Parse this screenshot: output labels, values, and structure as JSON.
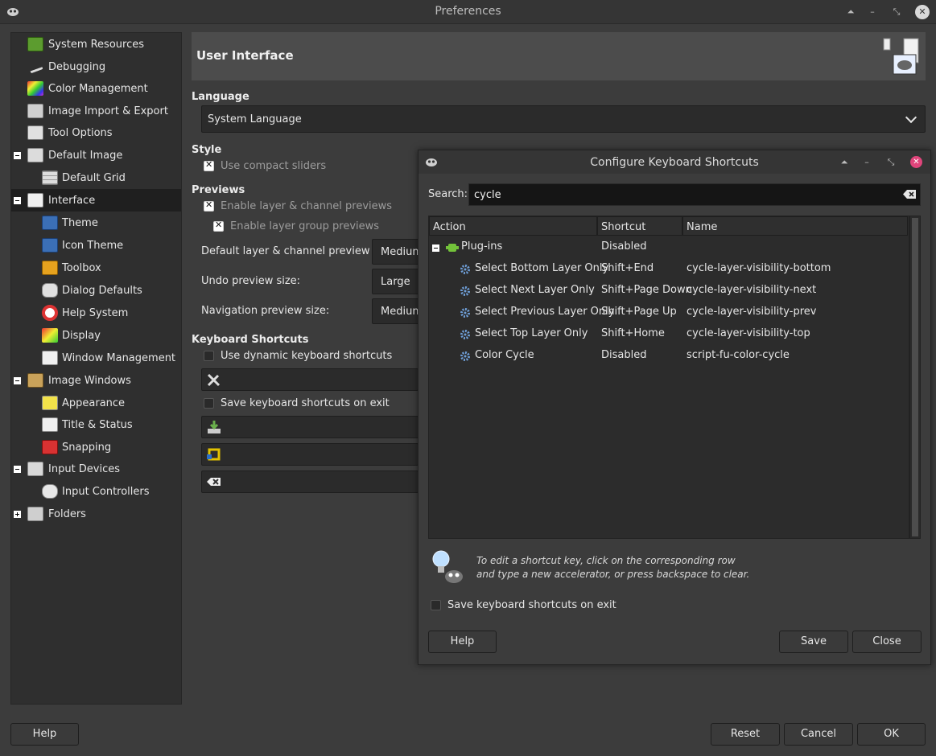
{
  "window": {
    "title": "Preferences"
  },
  "sidebar": {
    "items": [
      {
        "label": "System Resources",
        "icon": "system-resources-icon"
      },
      {
        "label": "Debugging",
        "icon": "debugging-icon"
      },
      {
        "label": "Color Management",
        "icon": "color-management-icon"
      },
      {
        "label": "Image Import & Export",
        "icon": "image-import-export-icon"
      },
      {
        "label": "Tool Options",
        "icon": "tool-options-icon"
      },
      {
        "label": "Default Image",
        "icon": "default-image-icon"
      },
      {
        "label": "Default Grid",
        "icon": "default-grid-icon"
      },
      {
        "label": "Interface",
        "icon": "interface-icon"
      },
      {
        "label": "Theme",
        "icon": "theme-icon"
      },
      {
        "label": "Icon Theme",
        "icon": "icon-theme-icon"
      },
      {
        "label": "Toolbox",
        "icon": "toolbox-icon"
      },
      {
        "label": "Dialog Defaults",
        "icon": "dialog-defaults-icon"
      },
      {
        "label": "Help System",
        "icon": "help-system-icon"
      },
      {
        "label": "Display",
        "icon": "display-icon"
      },
      {
        "label": "Window Management",
        "icon": "window-management-icon"
      },
      {
        "label": "Image Windows",
        "icon": "image-windows-icon"
      },
      {
        "label": "Appearance",
        "icon": "appearance-icon"
      },
      {
        "label": "Title & Status",
        "icon": "title-status-icon"
      },
      {
        "label": "Snapping",
        "icon": "snapping-icon"
      },
      {
        "label": "Input Devices",
        "icon": "input-devices-icon"
      },
      {
        "label": "Input Controllers",
        "icon": "input-controllers-icon"
      },
      {
        "label": "Folders",
        "icon": "folders-icon"
      }
    ]
  },
  "main": {
    "header_title": "User Interface",
    "language_title": "Language",
    "language_value": "System Language",
    "style_title": "Style",
    "compact_sliders": "Use compact sliders",
    "previews_title": "Previews",
    "enable_layer_previews": "Enable layer & channel previews",
    "enable_group_previews": "Enable layer group previews",
    "default_preview_size_label": "Default layer & channel preview size:",
    "default_preview_size_value": "Medium",
    "undo_preview_label": "Undo preview size:",
    "undo_preview_value": "Large",
    "nav_preview_label": "Navigation preview size:",
    "nav_preview_value": "Medium",
    "shortcuts_title": "Keyboard Shortcuts",
    "dynamic_shortcuts": "Use dynamic keyboard shortcuts",
    "save_on_exit": "Save keyboard shortcuts on exit"
  },
  "footer": {
    "help": "Help",
    "reset": "Reset",
    "cancel": "Cancel",
    "ok": "OK"
  },
  "dialog": {
    "title": "Configure Keyboard Shortcuts",
    "search_label": "Search:",
    "search_value": "cycle",
    "columns": [
      "Action",
      "Shortcut",
      "Name"
    ],
    "group": {
      "action": "Plug-ins",
      "shortcut": "Disabled"
    },
    "rows": [
      {
        "action": "Select Bottom Layer Only",
        "shortcut": "Shift+End",
        "name": "cycle-layer-visibility-bottom"
      },
      {
        "action": "Select Next Layer Only",
        "shortcut": "Shift+Page Down",
        "name": "cycle-layer-visibility-next"
      },
      {
        "action": "Select Previous Layer Only",
        "shortcut": "Shift+Page Up",
        "name": "cycle-layer-visibility-prev"
      },
      {
        "action": "Select Top Layer Only",
        "shortcut": "Shift+Home",
        "name": "cycle-layer-visibility-top"
      },
      {
        "action": "Color Cycle",
        "shortcut": "Disabled",
        "name": "script-fu-color-cycle"
      }
    ],
    "hint_line1": "To edit a shortcut key, click on the corresponding row",
    "hint_line2": "and type a new accelerator, or press backspace to clear.",
    "save_on_exit": "Save keyboard shortcuts on exit",
    "help": "Help",
    "save": "Save",
    "close": "Close"
  }
}
